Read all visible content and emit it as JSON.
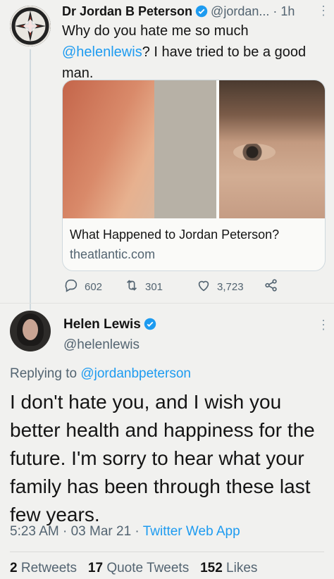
{
  "tweet1": {
    "author_name": "Dr Jordan B Peterson",
    "handle": "@jordan...",
    "separator": "·",
    "time": "1h",
    "text_mention": "@helenlewis",
    "text_line1": "Why do you hate me so much",
    "text_rest": "? I have tried to be a good man.",
    "card": {
      "title": "What Happened to Jordan Peterson?",
      "domain": "theatlantic.com"
    },
    "actions": {
      "replies": "602",
      "retweets": "301",
      "likes": "3,723"
    }
  },
  "tweet2": {
    "author_name": "Helen Lewis",
    "handle": "@helenlewis",
    "replying_prefix": "Replying to",
    "replying_to": "@jordanbpeterson",
    "text": "I don't hate you, and I wish you better health and happiness for the future. I'm sorry to hear what your family has been through these last few years.",
    "timestamp": "5:23 AM · 03 Mar 21 ·",
    "app": "Twitter Web App",
    "stats": {
      "retweets_count": "2",
      "retweets_label": "Retweets",
      "quotes_count": "17",
      "quotes_label": "Quote Tweets",
      "likes_count": "152",
      "likes_label": "Likes"
    }
  },
  "colors": {
    "accent": "#1d9bf0",
    "secondary_text": "#536471",
    "background": "#f1f1ef"
  },
  "icons": [
    "verified-badge-icon",
    "more-options-icon",
    "reply-icon",
    "retweet-icon",
    "like-icon",
    "share-icon"
  ]
}
